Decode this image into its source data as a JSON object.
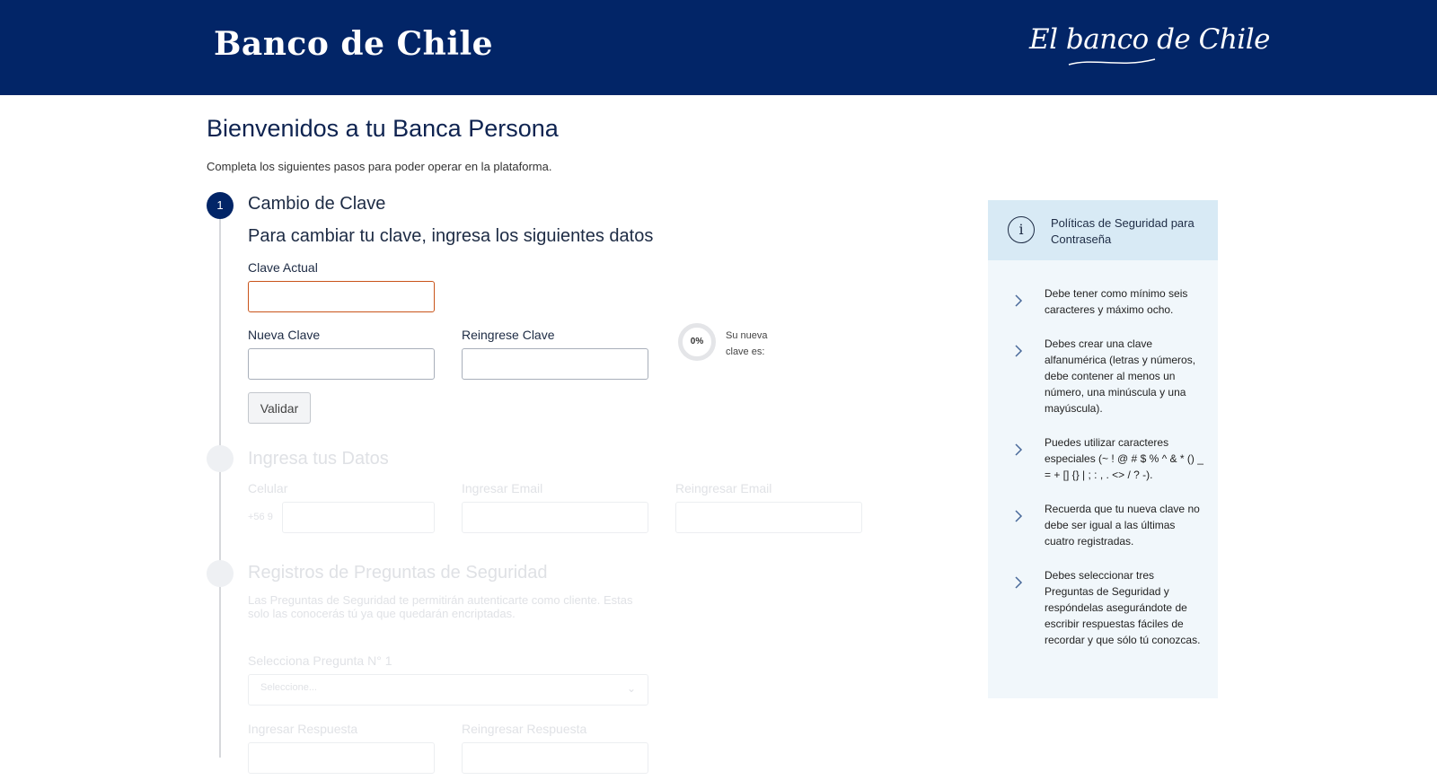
{
  "header": {
    "logo": "Banco de Chile",
    "slogan": "El banco de Chile"
  },
  "page": {
    "title": "Bienvenidos a tu Banca Persona",
    "subtitle": "Completa los siguientes pasos para poder operar en la plataforma."
  },
  "step1": {
    "number": "1",
    "title": "Cambio de Clave",
    "subtitle": "Para cambiar tu clave, ingresa los siguientes datos",
    "current_label": "Clave Actual",
    "new_label": "Nueva Clave",
    "repeat_label": "Reingrese Clave",
    "validate_label": "Validar",
    "strength_value": "0%",
    "strength_text": "Su nueva clave es:"
  },
  "step2": {
    "title": "Ingresa tus Datos",
    "phone_label": "Celular",
    "phone_prefix": "+56 9",
    "email_label": "Ingresar Email",
    "email_repeat_label": "Reingresar Email"
  },
  "step3": {
    "title": "Registros de Preguntas de Seguridad",
    "description": "Las Preguntas de Seguridad te permitirán autenticarte como cliente. Estas solo las conocerás tú ya que quedarán encriptadas.",
    "question_label": "Selecciona Pregunta N° 1",
    "question_placeholder": "Seleccione...",
    "answer_label": "Ingresar Respuesta",
    "answer_repeat_label": "Reingresar Respuesta"
  },
  "policy": {
    "title": "Políticas de Seguridad para Contraseña",
    "items": [
      "Debe tener como mínimo seis caracteres y máximo ocho.",
      "Debes crear una clave alfanumérica (letras y números, debe contener al menos un número, una minúscula y una mayúscula).",
      "Puedes utilizar caracteres especiales (~ ! @ # $ % ^ & * () _ = + [] {} | ; : , . <> / ? -).",
      "Recuerda que tu nueva clave no debe ser igual a las últimas cuatro registradas.",
      "Debes seleccionar tres Preguntas de Seguridad y respóndelas asegurándote de escribir respuestas fáciles de recordar y que sólo tú conozcas."
    ]
  },
  "colors": {
    "brand": "#022567",
    "error_border": "#c9541a",
    "policy_bg": "#f1f7fb",
    "policy_head_bg": "#d8eaf5"
  }
}
